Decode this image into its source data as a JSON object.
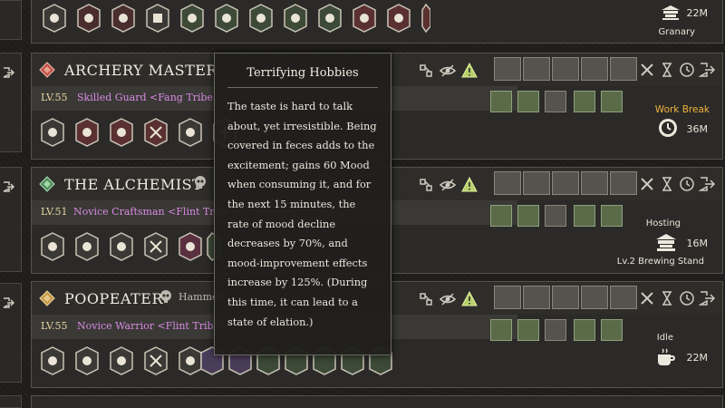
{
  "rows": [
    {
      "id": "top",
      "status": {
        "facility": "Granary",
        "time": "22M"
      }
    },
    {
      "id": "archery",
      "name": "ARCHERY MASTER",
      "level": "LV.55",
      "title": "Skilled Guard <Fang Tribe>",
      "status": {
        "label": "Work Break",
        "time": "36M"
      }
    },
    {
      "id": "alchemist",
      "name": "THE ALCHEMIST",
      "level": "LV.51",
      "title": "Novice Craftsman <Flint Tribe>",
      "status": {
        "label": "Hosting",
        "time": "16M",
        "facility": "Lv.2 Brewing Stand"
      }
    },
    {
      "id": "poopeater",
      "name": "POOPEATER",
      "assignment": "Hammer",
      "level": "LV.55",
      "title": "Novice Warrior <Flint Tribe>",
      "status": {
        "label": "Idle",
        "time": "22M"
      }
    }
  ],
  "tooltip": {
    "title": "Terrifying Hobbies",
    "body": "The taste is hard to talk about, yet irresistible. Being covered in feces adds to the excitement; gains 60 Mood when consuming it, and for the next 15 minutes, the rate of mood decline decreases by 70%, and mood-improvement effects increase by 125%. (During this time, it can lead to a state of elation.)"
  },
  "colors": {
    "title_purple": "#d98ae3",
    "level_gold": "#e7d6a0",
    "status_orange": "#f0b23c",
    "green_slot": "#5b6b4a"
  }
}
